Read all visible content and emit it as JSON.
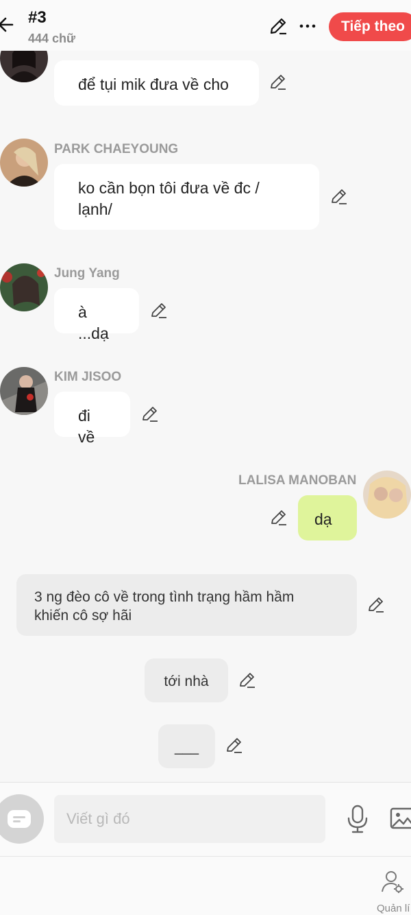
{
  "header": {
    "title": "#3",
    "subtitle": "444 chữ",
    "next_label": "Tiếp theo"
  },
  "messages": [
    {
      "speaker": "",
      "text": "để tụi mik đưa về cho"
    },
    {
      "speaker": "PARK CHAEYOUNG",
      "text": "ko cần bọn tôi đưa về đc /\nlạnh/"
    },
    {
      "speaker": "Jung Yang",
      "text": "à ...dạ"
    },
    {
      "speaker": "KIM JISOO",
      "text": "đi về"
    },
    {
      "speaker": "LALISA MANOBAN",
      "text": "dạ"
    }
  ],
  "narrations": [
    {
      "text": "3 ng đèo cô về trong tình trạng hầm hầm\nkhiến cô sợ hãi"
    },
    {
      "text": "tới nhà"
    },
    {
      "text": "___"
    }
  ],
  "input": {
    "placeholder": "Viết gì đó"
  },
  "character_bar": {
    "manage_label": "Quản lí"
  },
  "colors": {
    "accent": "#f04a4a",
    "my_bubble": "#dff49b",
    "narration_bg": "#ececec"
  }
}
